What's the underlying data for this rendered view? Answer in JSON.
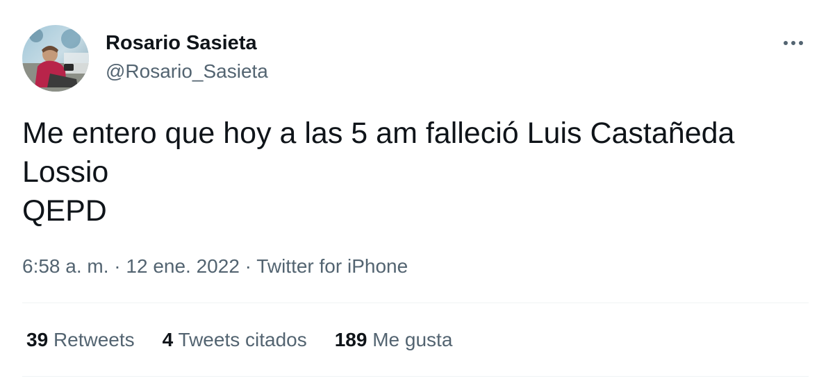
{
  "author": {
    "name": "Rosario Sasieta",
    "handle": "@Rosario_Sasieta"
  },
  "icons": {
    "more": "more-horizontal-icon"
  },
  "tweet": {
    "lines": [
      "Me entero que hoy a las 5 am falleció Luis Castañeda",
      "Lossio",
      "QEPD"
    ]
  },
  "meta": {
    "time": "6:58 a. m.",
    "sep1": " · ",
    "date": "12 ene. 2022",
    "sep2": " · ",
    "source": "Twitter for iPhone"
  },
  "stats": {
    "retweets": {
      "count": "39",
      "label": "Retweets"
    },
    "quotes": {
      "count": "4",
      "label": "Tweets citados"
    },
    "likes": {
      "count": "189",
      "label": "Me gusta"
    }
  },
  "colors": {
    "primary_text": "#0f1419",
    "secondary_text": "#536471",
    "divider": "#eff3f4"
  }
}
